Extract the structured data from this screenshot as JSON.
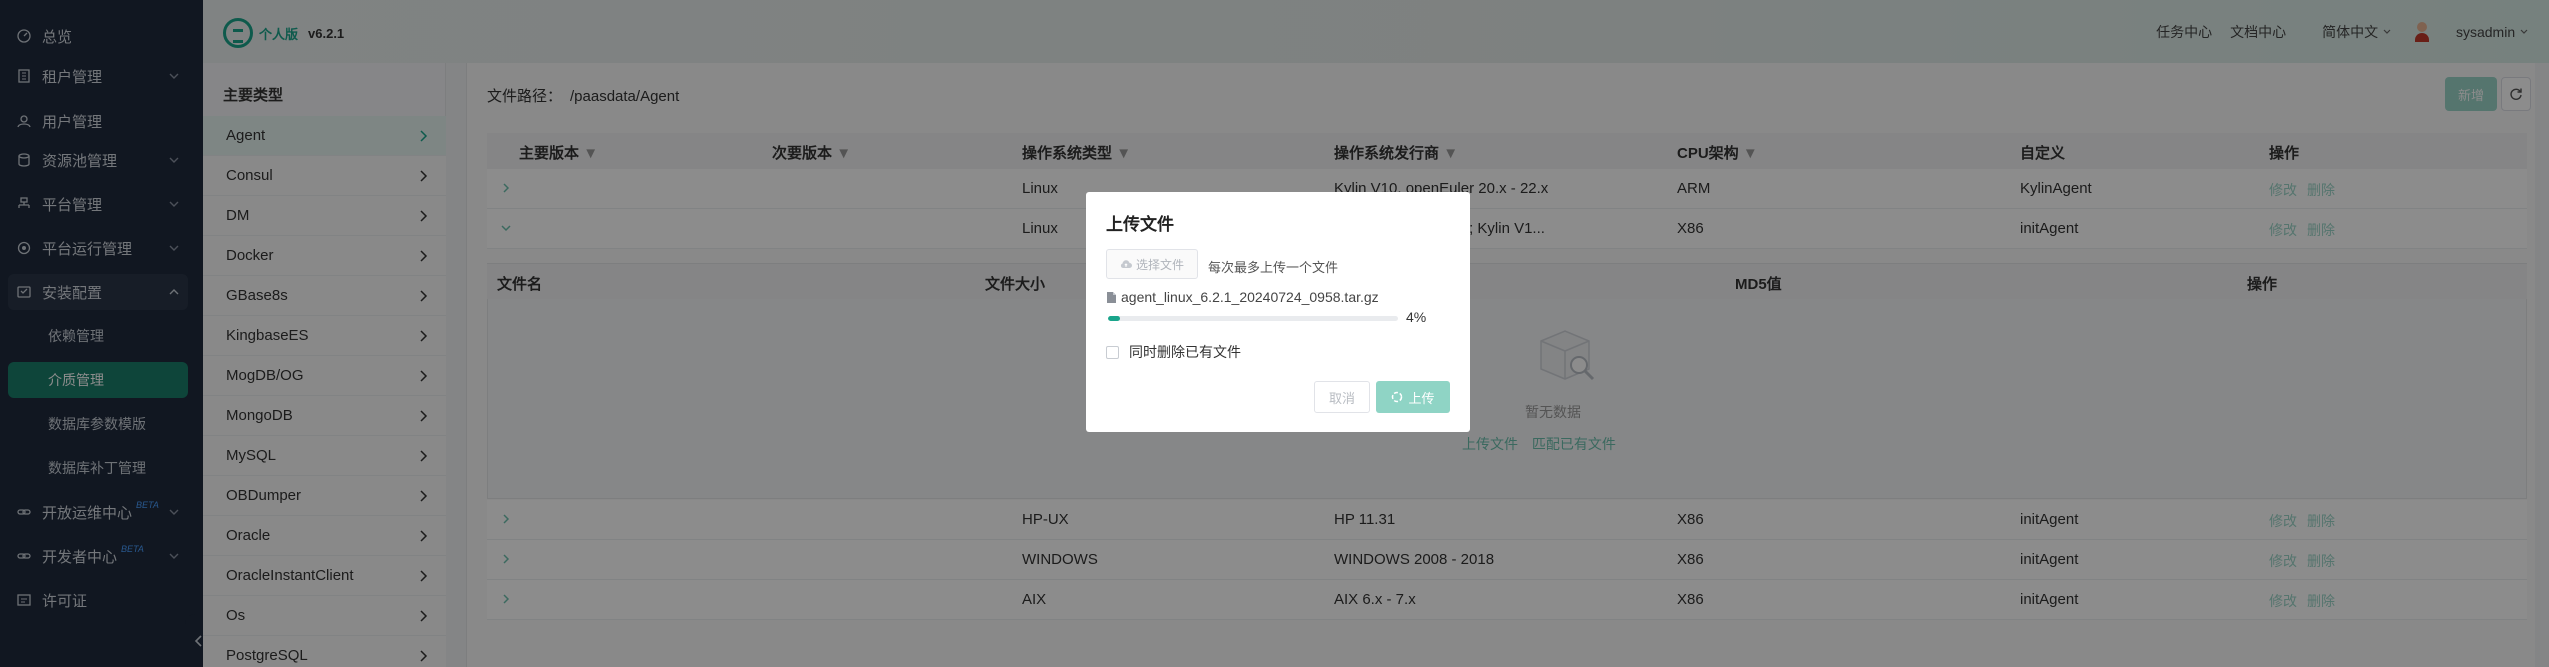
{
  "sidebar": {
    "items": [
      {
        "label": "总览"
      },
      {
        "label": "租户管理"
      },
      {
        "label": "用户管理"
      },
      {
        "label": "资源池管理"
      },
      {
        "label": "平台管理"
      },
      {
        "label": "平台运行管理"
      },
      {
        "label": "安装配置"
      },
      {
        "label": "开放运维中心",
        "badge": "BETA"
      },
      {
        "label": "开发者中心",
        "badge": "BETA"
      },
      {
        "label": "许可证"
      }
    ],
    "sub_items": [
      {
        "label": "依赖管理"
      },
      {
        "label": "介质管理"
      },
      {
        "label": "数据库参数模版"
      },
      {
        "label": "数据库补丁管理"
      }
    ]
  },
  "header": {
    "brand": "个人版",
    "version": "v6.2.1",
    "nav": [
      "任务中心",
      "文档中心",
      "简体中文"
    ],
    "user": "sysadmin"
  },
  "categories": {
    "title": "主要类型",
    "items": [
      "Agent",
      "Consul",
      "DM",
      "Docker",
      "GBase8s",
      "KingbaseES",
      "MogDB/OG",
      "MongoDB",
      "MySQL",
      "OBDumper",
      "Oracle",
      "OracleInstantClient",
      "Os",
      "PostgreSQL"
    ]
  },
  "main": {
    "path_label": "文件路径：",
    "path_value": "/paasdata/Agent",
    "new_button": "新增",
    "columns": [
      "主要版本",
      "次要版本",
      "操作系统类型",
      "操作系统发行商",
      "CPU架构",
      "自定义",
      "操作"
    ],
    "rows": [
      {
        "os_type": "Linux",
        "vendor": "Kylin V10, openEuler 20.x - 22.x",
        "cpu": "ARM",
        "custom": "KylinAgent"
      },
      {
        "os_type": "Linux",
        "vendor": "CentOS 5.7, 6.x, 7.x; Kylin V1...",
        "cpu": "X86",
        "custom": "initAgent"
      },
      {
        "os_type": "HP-UX",
        "vendor": "HP 11.31",
        "cpu": "X86",
        "custom": "initAgent"
      },
      {
        "os_type": "WINDOWS",
        "vendor": "WINDOWS 2008 - 2018",
        "cpu": "X86",
        "custom": "initAgent"
      },
      {
        "os_type": "AIX",
        "vendor": "AIX 6.x - 7.x",
        "cpu": "X86",
        "custom": "initAgent"
      }
    ],
    "actions": {
      "edit": "修改",
      "delete": "删除"
    },
    "sub_columns": [
      "文件名",
      "文件大小",
      "MD5值",
      "操作"
    ],
    "empty_text": "暂无数据",
    "empty_links": [
      "上传文件",
      "匹配已有文件"
    ]
  },
  "modal": {
    "title": "上传文件",
    "choose_button": "选择文件",
    "choose_tip": "每次最多上传一个文件",
    "file_name": "agent_linux_6.2.1_20240724_0958.tar.gz",
    "progress": 4,
    "progress_text": "4%",
    "checkbox_label": "同时删除已有文件",
    "cancel": "取消",
    "upload": "上传"
  },
  "colors": {
    "accent": "#1aa58b",
    "sidebar_bg": "#1f2a3c"
  }
}
